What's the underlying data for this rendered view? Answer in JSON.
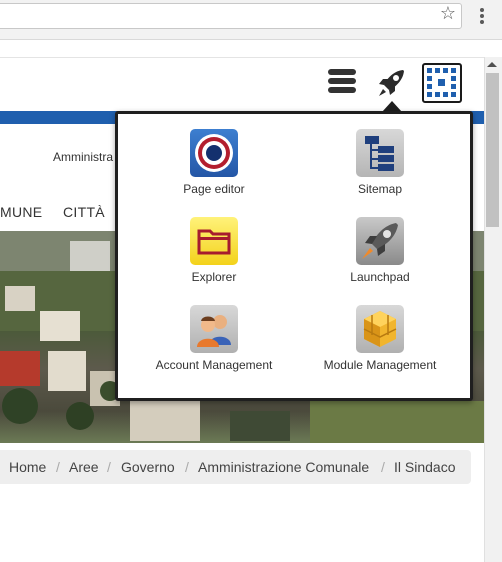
{
  "browser": {
    "star_icon": "star-icon",
    "menu_icon": "kebab-menu-icon"
  },
  "toolbar": {
    "icons": [
      "hamburger-menu-icon",
      "rocket-icon",
      "app-grid-icon"
    ]
  },
  "site": {
    "subtitle_fragment": "Amministra",
    "nav": [
      "MUNE",
      "CITTÀ"
    ]
  },
  "breadcrumb": {
    "items": [
      "Home",
      "Aree",
      "Governo",
      "Amministrazione Comunale",
      "Il Sindaco"
    ],
    "separator": "/"
  },
  "launcher": {
    "tiles": [
      {
        "label": "Page editor",
        "icon": "target-icon"
      },
      {
        "label": "Sitemap",
        "icon": "sitemap-icon"
      },
      {
        "label": "Explorer",
        "icon": "folder-icon"
      },
      {
        "label": "Launchpad",
        "icon": "rocket-icon"
      },
      {
        "label": "Account Management",
        "icon": "users-icon"
      },
      {
        "label": "Module Management",
        "icon": "cubes-icon"
      }
    ]
  },
  "colors": {
    "brand_blue": "#1f5fae",
    "popup_border": "#1f1f1f"
  }
}
